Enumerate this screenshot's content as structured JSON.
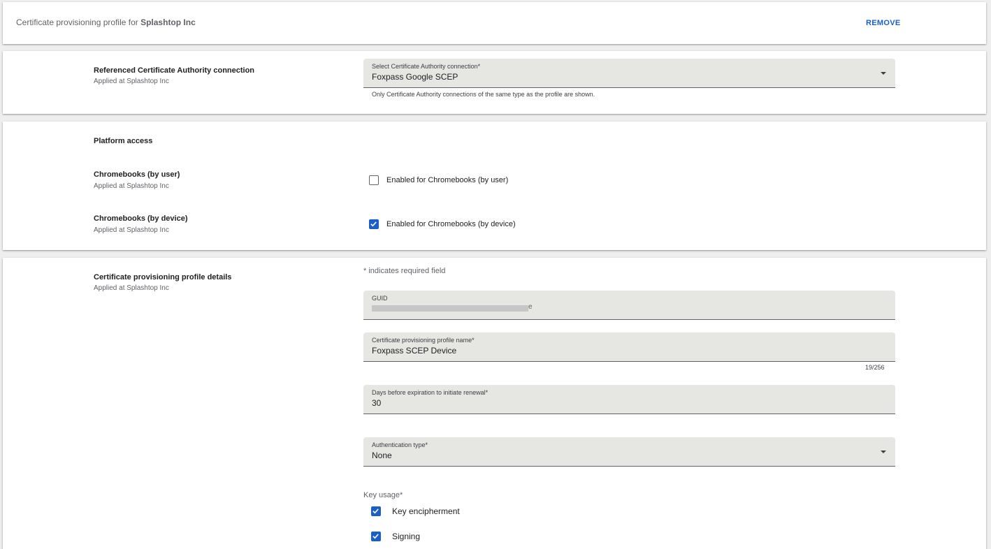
{
  "header": {
    "title_prefix": "Certificate provisioning profile for",
    "org_name": "Splashtop Inc",
    "remove_label": "REMOVE"
  },
  "ca_section": {
    "title": "Referenced Certificate Authority connection",
    "applied": "Applied at Splashtop Inc",
    "select_label": "Select Certificate Authority connection*",
    "select_value": "Foxpass Google SCEP",
    "helper": "Only Certificate Authority connections of the same type as the profile are shown."
  },
  "platform_section": {
    "title": "Platform access",
    "items": [
      {
        "title": "Chromebooks (by user)",
        "applied": "Applied at Splashtop Inc",
        "checkbox_label": "Enabled for Chromebooks (by user)",
        "checked": false
      },
      {
        "title": "Chromebooks (by device)",
        "applied": "Applied at Splashtop Inc",
        "checkbox_label": "Enabled for Chromebooks (by device)",
        "checked": true
      }
    ]
  },
  "details_section": {
    "title": "Certificate provisioning profile details",
    "applied": "Applied at Splashtop Inc",
    "required_note": "* indicates required field",
    "guid_label": "GUID",
    "guid_tail": "e",
    "name_label": "Certificate provisioning profile name*",
    "name_value": "Foxpass SCEP Device",
    "name_counter": "19/256",
    "renewal_label": "Days before expiration to initiate renewal*",
    "renewal_value": "30",
    "auth_label": "Authentication type*",
    "auth_value": "None",
    "key_usage_label": "Key usage*",
    "key_usage": [
      {
        "label": "Key encipherment",
        "checked": true
      },
      {
        "label": "Signing",
        "checked": true
      }
    ]
  },
  "colors": {
    "accent": "#1a5fc9",
    "field_bg": "#e6e6e3",
    "page_bg": "#eeeeee"
  }
}
